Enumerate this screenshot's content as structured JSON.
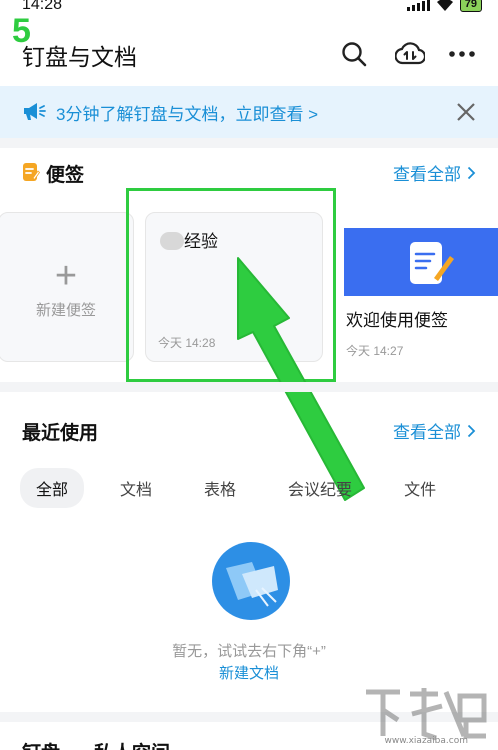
{
  "status_bar": {
    "time": "14:28",
    "battery": "79"
  },
  "step_badge": "5",
  "header": {
    "title": "钉盘与文档",
    "icons": [
      "search-icon",
      "cloud-transfer-icon",
      "more-icon"
    ]
  },
  "banner": {
    "text": "3分钟了解钉盘与文档，立即查看 >",
    "icon": "megaphone-icon"
  },
  "notes": {
    "title": "便签",
    "view_all": "查看全部",
    "new_label": "新建便签",
    "cards": [
      {
        "title": "经验",
        "time": "今天 14:28"
      },
      {
        "title": "欢迎使用便签",
        "time": "今天 14:27"
      }
    ]
  },
  "recent": {
    "title": "最近使用",
    "view_all": "查看全部",
    "tabs": [
      "全部",
      "文档",
      "表格",
      "会议纪要",
      "文件"
    ],
    "active_tab": 0,
    "empty_text": "暂无，试试去右下角“+”",
    "empty_link": "新建文档"
  },
  "bottom": {
    "labels": [
      "钉盘",
      "私人空间"
    ]
  },
  "watermark": {
    "text": "www.xiazaiba.com"
  },
  "colors": {
    "accent": "#1a8fd6",
    "highlight": "#2ecc40",
    "banner_bg": "#e6f3fd"
  }
}
